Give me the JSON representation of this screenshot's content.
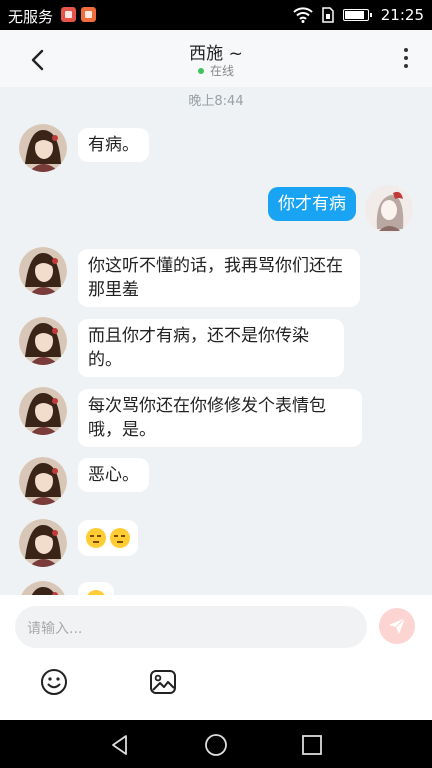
{
  "status_bar": {
    "carrier": "无服务",
    "time": "21:25",
    "icons": [
      "app-notification-icon",
      "app-notification-icon",
      "wifi-icon",
      "sim-icon",
      "battery-icon"
    ],
    "battery_level": 0.8
  },
  "header": {
    "title": "西施 ~",
    "status": "在线",
    "online_color": "#3cc55a"
  },
  "chat": {
    "timestamp": "晚上8:44",
    "messages": [
      {
        "from": "other",
        "text": "有病。"
      },
      {
        "from": "me",
        "text": "你才有病"
      },
      {
        "from": "other",
        "text": "你这听不懂的话，我再骂你们还在那里羞"
      },
      {
        "from": "other",
        "text": "而且你才有病，还不是你传染的。"
      },
      {
        "from": "other",
        "text": "每次骂你还在你修修发个表情包哦，是。"
      },
      {
        "from": "other",
        "text": "恶心。"
      },
      {
        "from": "other",
        "emoji": [
          "unamused-face-emoji",
          "unamused-face-emoji"
        ]
      },
      {
        "from": "other",
        "emoji": [
          "smiley-emoji"
        ]
      }
    ]
  },
  "composer": {
    "placeholder": "请输入..."
  },
  "colors": {
    "outgoing_bubble": "#19a3f3",
    "incoming_bubble": "#ffffff",
    "send_button": "#fcd4d2",
    "background": "#eef2f5"
  }
}
